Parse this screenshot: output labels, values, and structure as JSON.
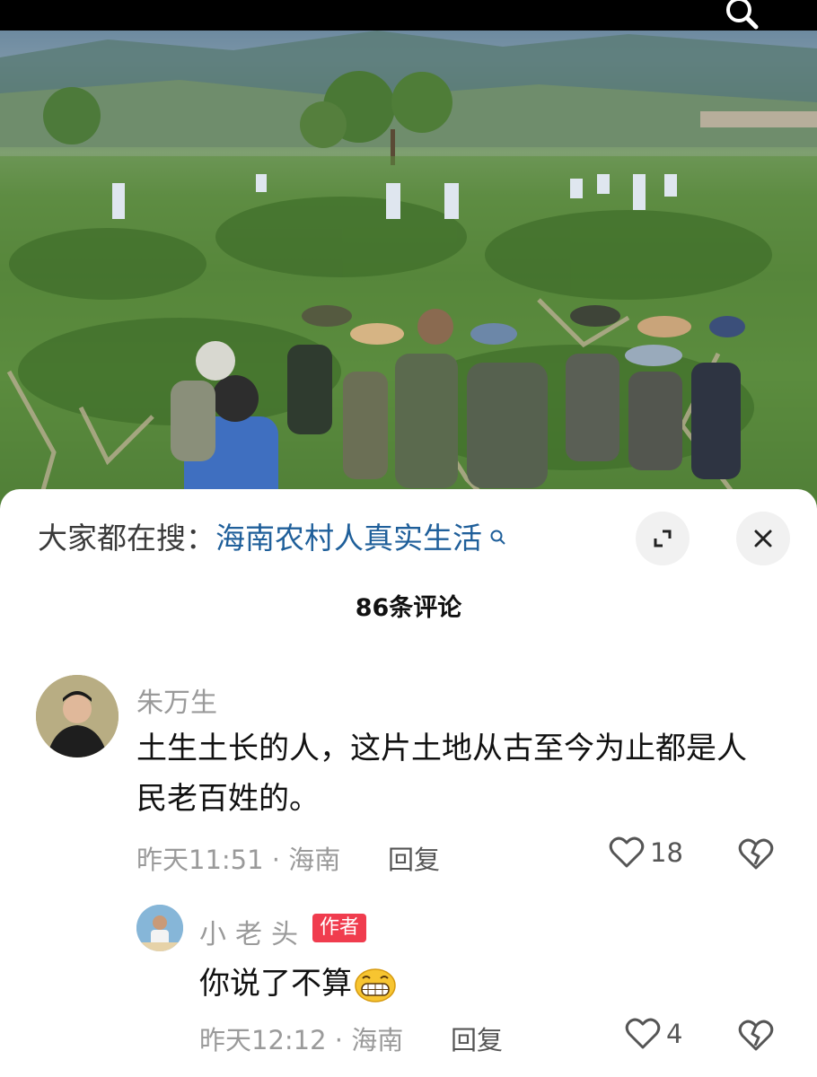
{
  "search_suggest": {
    "prefix": "大家都在搜：",
    "term": "海南农村人真实生活"
  },
  "comments_header": {
    "count_label": "86条评论"
  },
  "comments": [
    {
      "user": "朱万生",
      "text": "土生土长的人，这片土地从古至今为止都是人民老百姓的。",
      "meta": "昨天11:51 · 海南",
      "reply_label": "回复",
      "likes": "18"
    },
    {
      "user": "小老头",
      "badge": "作者",
      "text": "你说了不算",
      "meta": "昨天12:12 · 海南",
      "reply_label": "回复",
      "likes": "4"
    }
  ],
  "icons": {
    "search": "search-icon",
    "expand": "expand-icon",
    "close": "close-icon",
    "like": "heart-icon",
    "dislike": "broken-heart-icon",
    "emoji": "grin-emoji-icon"
  },
  "colors": {
    "link": "#1f5f9a",
    "badge": "#f03c4e",
    "muted": "#9a9a9a"
  }
}
